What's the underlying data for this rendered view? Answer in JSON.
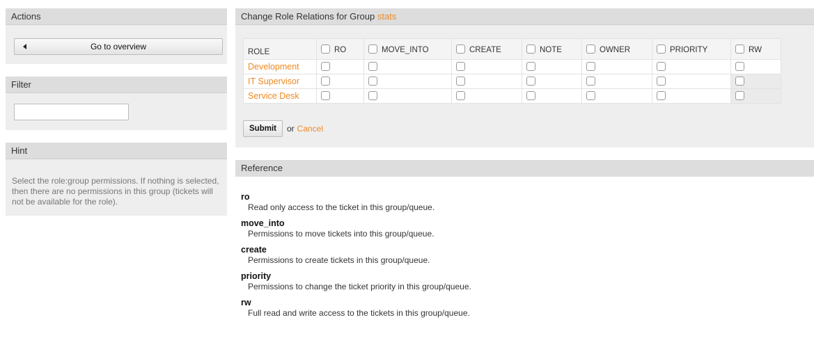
{
  "sidebar": {
    "actions": {
      "title": "Actions",
      "overview_label": "Go to overview"
    },
    "filter": {
      "title": "Filter",
      "placeholder": ""
    },
    "hint": {
      "title": "Hint",
      "text": "Select the role:group permissions. If nothing is selected, then there are no permissions in this group (tickets will not be available for the role)."
    }
  },
  "main": {
    "title_prefix": "Change Role Relations for Group",
    "group_name": "stats",
    "table": {
      "role_header": "ROLE",
      "permissions": [
        "RO",
        "MOVE_INTO",
        "CREATE",
        "NOTE",
        "OWNER",
        "PRIORITY",
        "RW"
      ],
      "roles": [
        "Development",
        "IT Supervisor",
        "Service Desk"
      ]
    },
    "submit_label": "Submit",
    "or_text": "or",
    "cancel_label": "Cancel"
  },
  "reference": {
    "title": "Reference",
    "items": [
      {
        "term": "ro",
        "desc": "Read only access to the ticket in this group/queue."
      },
      {
        "term": "move_into",
        "desc": "Permissions to move tickets into this group/queue."
      },
      {
        "term": "create",
        "desc": "Permissions to create tickets in this group/queue."
      },
      {
        "term": "priority",
        "desc": "Permissions to change the ticket priority in this group/queue."
      },
      {
        "term": "rw",
        "desc": "Full read and write access to the tickets in this group/queue."
      }
    ]
  },
  "colors": {
    "accent": "#ee8a23",
    "panel": "#eeeeee",
    "header": "#dddddd"
  }
}
